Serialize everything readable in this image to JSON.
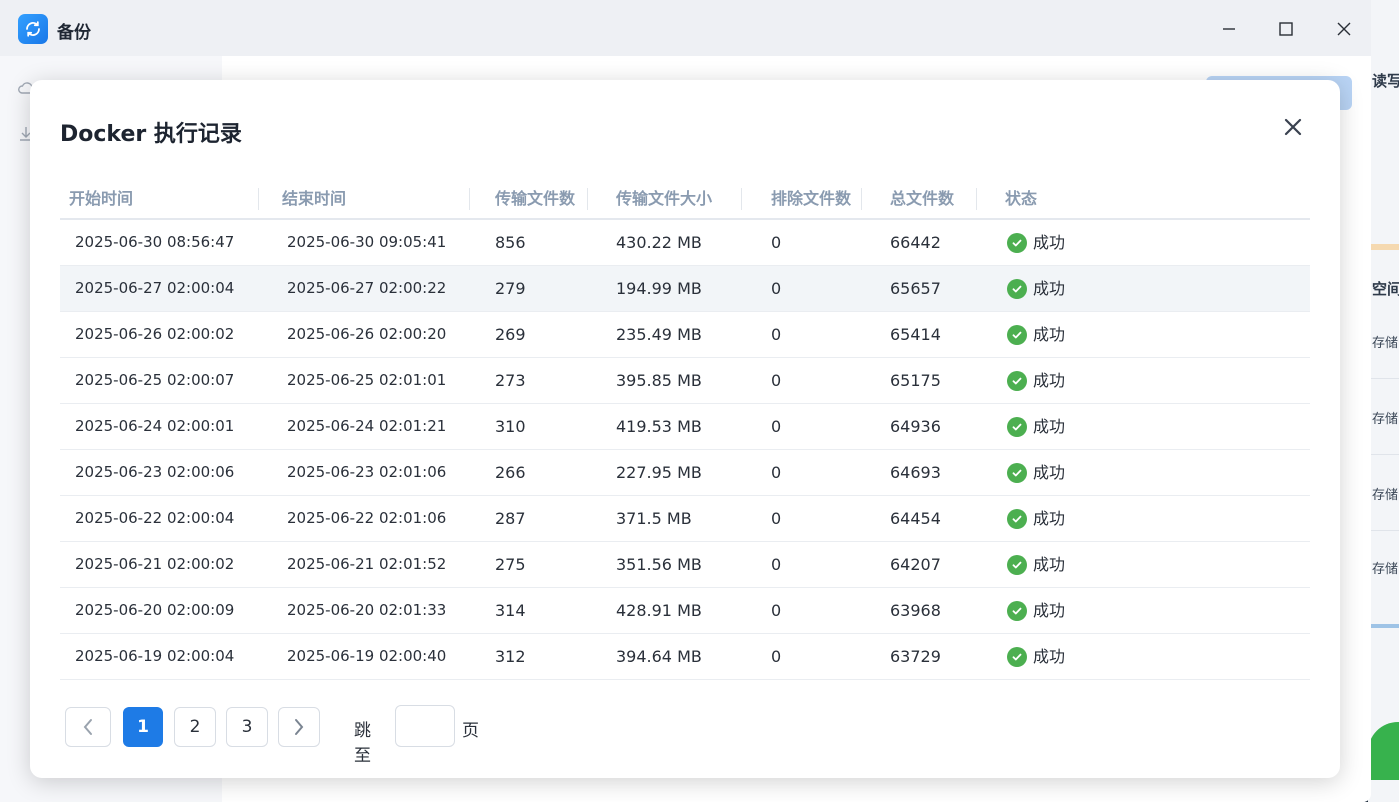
{
  "window": {
    "title": "备份",
    "colors": {
      "accent": "#1e7be6",
      "success": "#4caf50"
    }
  },
  "background": {
    "right_texts": [
      "读写",
      "空间",
      "存储",
      "存储",
      "存储",
      "存储"
    ]
  },
  "modal": {
    "title": "Docker 执行记录",
    "columns": [
      "开始时间",
      "结束时间",
      "传输文件数",
      "传输文件大小",
      "排除文件数",
      "总文件数",
      "状态"
    ],
    "rows": [
      {
        "start": "2025-06-30 08:56:47",
        "end": "2025-06-30 09:05:41",
        "count": "856",
        "size": "430.22 MB",
        "excluded": "0",
        "total": "66442",
        "status": "成功"
      },
      {
        "start": "2025-06-27 02:00:04",
        "end": "2025-06-27 02:00:22",
        "count": "279",
        "size": "194.99 MB",
        "excluded": "0",
        "total": "65657",
        "status": "成功"
      },
      {
        "start": "2025-06-26 02:00:02",
        "end": "2025-06-26 02:00:20",
        "count": "269",
        "size": "235.49 MB",
        "excluded": "0",
        "total": "65414",
        "status": "成功"
      },
      {
        "start": "2025-06-25 02:00:07",
        "end": "2025-06-25 02:01:01",
        "count": "273",
        "size": "395.85 MB",
        "excluded": "0",
        "total": "65175",
        "status": "成功"
      },
      {
        "start": "2025-06-24 02:00:01",
        "end": "2025-06-24 02:01:21",
        "count": "310",
        "size": "419.53 MB",
        "excluded": "0",
        "total": "64936",
        "status": "成功"
      },
      {
        "start": "2025-06-23 02:00:06",
        "end": "2025-06-23 02:01:06",
        "count": "266",
        "size": "227.95 MB",
        "excluded": "0",
        "total": "64693",
        "status": "成功"
      },
      {
        "start": "2025-06-22 02:00:04",
        "end": "2025-06-22 02:01:06",
        "count": "287",
        "size": "371.5 MB",
        "excluded": "0",
        "total": "64454",
        "status": "成功"
      },
      {
        "start": "2025-06-21 02:00:02",
        "end": "2025-06-21 02:01:52",
        "count": "275",
        "size": "351.56 MB",
        "excluded": "0",
        "total": "64207",
        "status": "成功"
      },
      {
        "start": "2025-06-20 02:00:09",
        "end": "2025-06-20 02:01:33",
        "count": "314",
        "size": "428.91 MB",
        "excluded": "0",
        "total": "63968",
        "status": "成功"
      },
      {
        "start": "2025-06-19 02:00:04",
        "end": "2025-06-19 02:00:40",
        "count": "312",
        "size": "394.64 MB",
        "excluded": "0",
        "total": "63729",
        "status": "成功"
      }
    ],
    "pagination": {
      "pages": [
        "1",
        "2",
        "3"
      ],
      "current": "1",
      "jump_label": "跳至",
      "page_suffix": "页",
      "jump_value": ""
    }
  }
}
